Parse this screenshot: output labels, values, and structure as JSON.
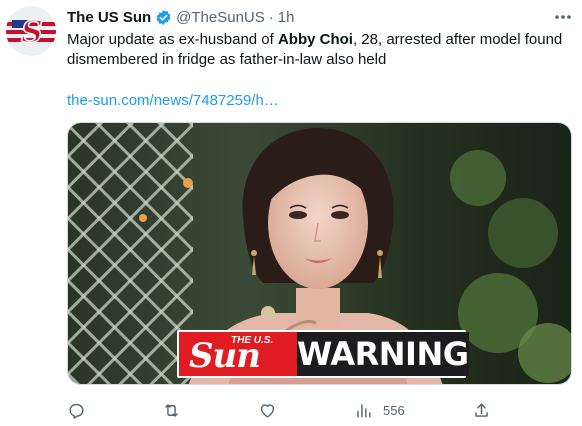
{
  "tweet": {
    "author": {
      "display_name": "The US Sun",
      "handle": "@TheSunUS",
      "separator": "·",
      "time": "1h",
      "verified": true,
      "avatar_icon": "us-sun-logo-avatar"
    },
    "text_parts": {
      "before": "Major update as ex-husband of ",
      "bold": "Abby Choi",
      "after": ", 28, arrested after model found dismembered in fridge as father-in-law also held"
    },
    "link_text": "the-sun.com/news/7487259/h…",
    "media": {
      "badge_logo_top": "THE U.S.",
      "badge_logo": "Sun",
      "badge_text": "WARNING",
      "badge_red": "#e11b22",
      "badge_dark": "#1d1d1f"
    },
    "actions": {
      "reply_icon": "reply-icon",
      "retweet_icon": "retweet-icon",
      "like_icon": "heart-icon",
      "views_icon": "views-chart-icon",
      "views_count": "556",
      "share_icon": "share-icon"
    },
    "colors": {
      "text": "#0f1419",
      "muted": "#536471",
      "link": "#1d9bf0",
      "verified": "#1d9bf0"
    }
  }
}
